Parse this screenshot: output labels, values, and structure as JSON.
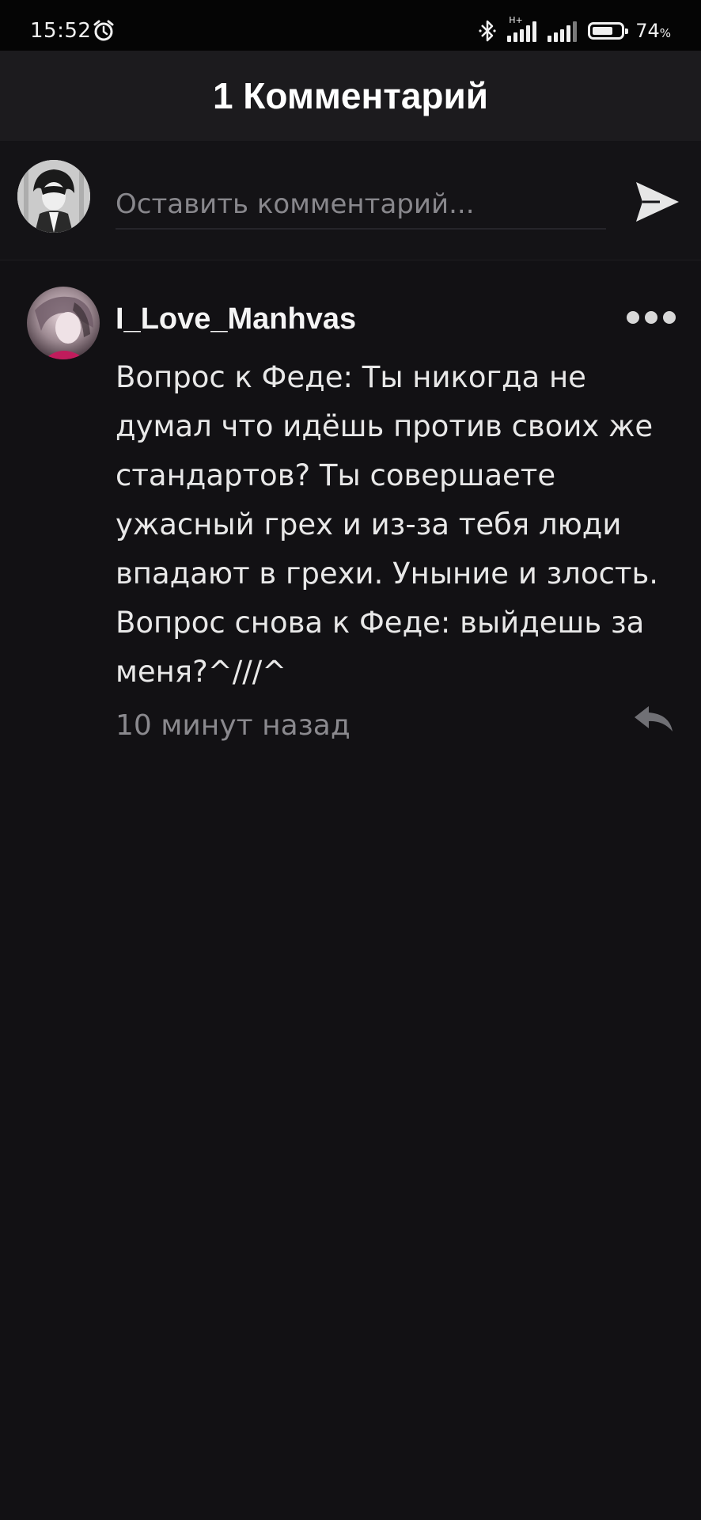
{
  "status_bar": {
    "time": "15:52",
    "network_label": "H+",
    "battery_percent": "74",
    "battery_level": 0.74,
    "icons": [
      "alarm-icon",
      "bluetooth-icon",
      "signal-icon",
      "signal-icon",
      "battery-icon"
    ]
  },
  "header": {
    "title": "1 Комментарий"
  },
  "composer": {
    "placeholder": "Оставить комментарий...",
    "send_icon": "send-icon"
  },
  "comments": [
    {
      "author": "I_Love_Manhvas",
      "text": "Вопрос к Феде: Ты никогда не думал что идёшь против своих же стандартов? Ты совершаете ужасный грех и из-за тебя люди впадают в грехи. Уныние и злость. Вопрос снова к Феде: выйдешь за меня?^///^",
      "time": "10 минут назад",
      "more_icon": "more-icon",
      "reply_icon": "reply-icon"
    }
  ],
  "colors": {
    "background": "#121114",
    "header_background": "#1c1b1e",
    "status_bar_background": "#050505",
    "text_primary": "#e8e8e8",
    "text_secondary": "#8a898e"
  }
}
